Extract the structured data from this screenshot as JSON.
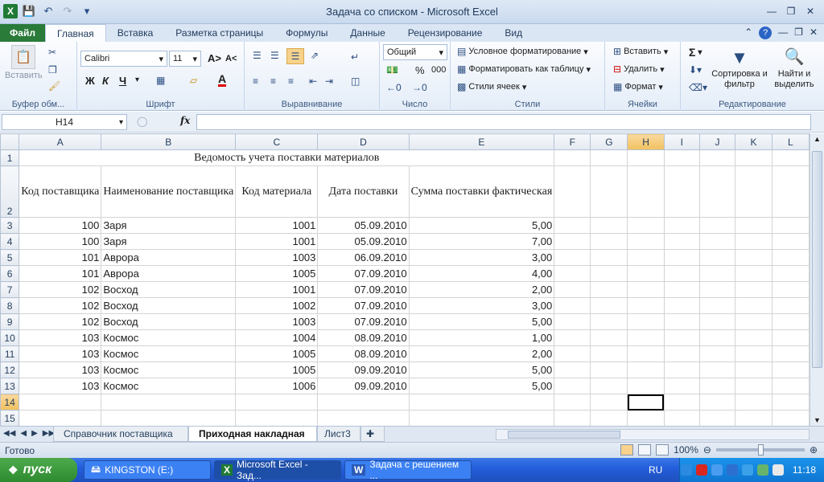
{
  "window": {
    "title": "Задача со списком  -  Microsoft Excel"
  },
  "ribbon": {
    "tabs": [
      "Файл",
      "Главная",
      "Вставка",
      "Разметка страницы",
      "Формулы",
      "Данные",
      "Рецензирование",
      "Вид"
    ],
    "clipboard": {
      "paste": "Вставить",
      "label": "Буфер обм..."
    },
    "font": {
      "name": "Calibri",
      "size": "11",
      "bold": "Ж",
      "italic": "К",
      "underline": "Ч",
      "label": "Шрифт"
    },
    "alignment": {
      "label": "Выравнивание"
    },
    "number": {
      "format": "Общий",
      "label": "Число",
      "percent": "%",
      "thousands": "000"
    },
    "styles": {
      "conditional": "Условное форматирование",
      "as_table": "Форматировать как таблицу",
      "cell_styles": "Стили ячеек",
      "label": "Стили"
    },
    "cells": {
      "insert": "Вставить",
      "delete": "Удалить",
      "format": "Формат",
      "label": "Ячейки"
    },
    "editing": {
      "sigma": "Σ",
      "sort": "Сортировка и фильтр",
      "find": "Найти и выделить",
      "label": "Редактирование"
    }
  },
  "formula_bar": {
    "name_box": "H14",
    "fx": "fx",
    "value": ""
  },
  "sheet": {
    "columns": [
      "A",
      "B",
      "C",
      "D",
      "E",
      "F",
      "G",
      "H",
      "I",
      "J",
      "K",
      "L"
    ],
    "title": "Ведомость учета поставки материалов",
    "headers": [
      "Код поставщика",
      "Наименование поставщика",
      "Код материала",
      "Дата поставки",
      "Сумма поставки фактическая"
    ],
    "rows": [
      [
        "100",
        "Заря",
        "1001",
        "05.09.2010",
        "5,00"
      ],
      [
        "100",
        "Заря",
        "1001",
        "05.09.2010",
        "7,00"
      ],
      [
        "101",
        "Аврора",
        "1003",
        "06.09.2010",
        "3,00"
      ],
      [
        "101",
        "Аврора",
        "1005",
        "07.09.2010",
        "4,00"
      ],
      [
        "102",
        "Восход",
        "1001",
        "07.09.2010",
        "2,00"
      ],
      [
        "102",
        "Восход",
        "1002",
        "07.09.2010",
        "3,00"
      ],
      [
        "102",
        "Восход",
        "1003",
        "07.09.2010",
        "5,00"
      ],
      [
        "103",
        "Космос",
        "1004",
        "08.09.2010",
        "1,00"
      ],
      [
        "103",
        "Космос",
        "1005",
        "08.09.2010",
        "2,00"
      ],
      [
        "103",
        "Космос",
        "1005",
        "09.09.2010",
        "5,00"
      ],
      [
        "103",
        "Космос",
        "1006",
        "09.09.2010",
        "5,00"
      ]
    ],
    "row_numbers": [
      "1",
      "2",
      "3",
      "4",
      "5",
      "6",
      "7",
      "8",
      "9",
      "10",
      "11",
      "12",
      "13",
      "14",
      "15"
    ]
  },
  "sheet_tabs": [
    "Справочник поставщика",
    "Приходная накладная",
    "Лист3"
  ],
  "status": {
    "ready": "Готово",
    "zoom": "100%"
  },
  "taskbar": {
    "start": "пуск",
    "items": [
      "KINGSTON (E:)",
      "Microsoft Excel - Зад...",
      "Задача с решением ..."
    ],
    "lang": "RU",
    "clock": "11:18"
  },
  "colors": {
    "excel_green": "#1f7a35",
    "file_tab": "#2a7a3a",
    "selected_header": "#f1c15f",
    "taskbar": "#245edb"
  }
}
